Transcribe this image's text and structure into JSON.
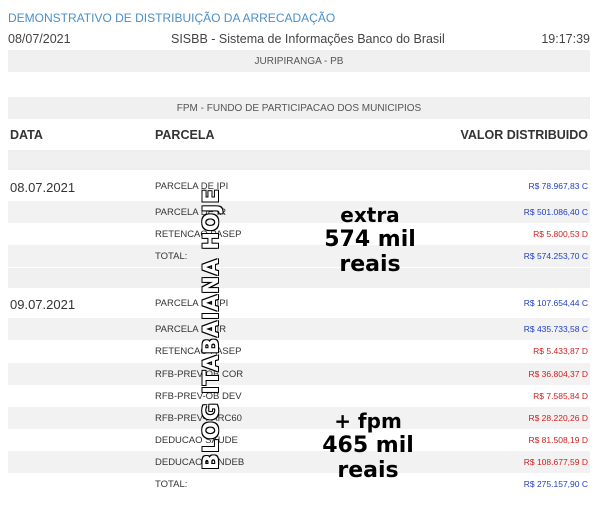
{
  "header": {
    "title": "DEMONSTRATIVO DE DISTRIBUIÇÃO DA ARRECADAÇÃO",
    "date": "08/07/2021",
    "system": "SISBB - Sistema de Informações Banco do Brasil",
    "time": "19:17:39"
  },
  "municipality": "JURIPIRANGA - PB",
  "fund": "FPM - FUNDO DE PARTICIPACAO DOS MUNICIPIOS",
  "columns": {
    "date": "DATA",
    "parcel": "PARCELA",
    "value": "VALOR DISTRIBUIDO"
  },
  "watermark": "BLOG ITABAIANA HOJE",
  "group1": {
    "date": "08.07.2021",
    "rows": [
      {
        "parcel": "PARCELA DE IPI",
        "value": "R$ 78.967,83 C",
        "color": "#1f3fc2"
      },
      {
        "parcel": "PARCELA DE IR",
        "value": "R$ 501.086,40 C",
        "color": "#1f3fc2"
      },
      {
        "parcel": "RETENCAO PASEP",
        "value": "R$ 5.800,53 D",
        "color": "#d02020"
      },
      {
        "parcel": "TOTAL:",
        "value": "R$ 574.253,70 C",
        "color": "#1f3fc2"
      }
    ]
  },
  "group2": {
    "date": "09.07.2021",
    "rows": [
      {
        "parcel": "PARCELA DE IPI",
        "value": "R$ 107.654,44 C",
        "color": "#1f3fc2"
      },
      {
        "parcel": "PARCELA DE IR",
        "value": "R$ 435.733,58 C",
        "color": "#1f3fc2"
      },
      {
        "parcel": "RETENCAO PASEP",
        "value": "R$ 5.433,87 D",
        "color": "#d02020"
      },
      {
        "parcel": "RFB-PREV-OB COR",
        "value": "R$ 36.804,37 D",
        "color": "#d02020"
      },
      {
        "parcel": "RFB-PREV-OB DEV",
        "value": "R$ 7.585,84 D",
        "color": "#d02020"
      },
      {
        "parcel": "RFB-PREV-PARC60",
        "value": "R$ 28.220,26 D",
        "color": "#d02020"
      },
      {
        "parcel": "DEDUCAO SAUDE",
        "value": "R$ 81.508,19 D",
        "color": "#d02020"
      },
      {
        "parcel": "DEDUCAO FUNDEB",
        "value": "R$ 108.677,59 D",
        "color": "#d02020"
      },
      {
        "parcel": "TOTAL:",
        "value": "R$ 275.157,90 C",
        "color": "#1f3fc2"
      }
    ]
  },
  "overlay1": {
    "line1": "extra",
    "line2": "574 mil reais"
  },
  "overlay2": {
    "line1": "+ fpm",
    "line2": "465 mil reais"
  }
}
